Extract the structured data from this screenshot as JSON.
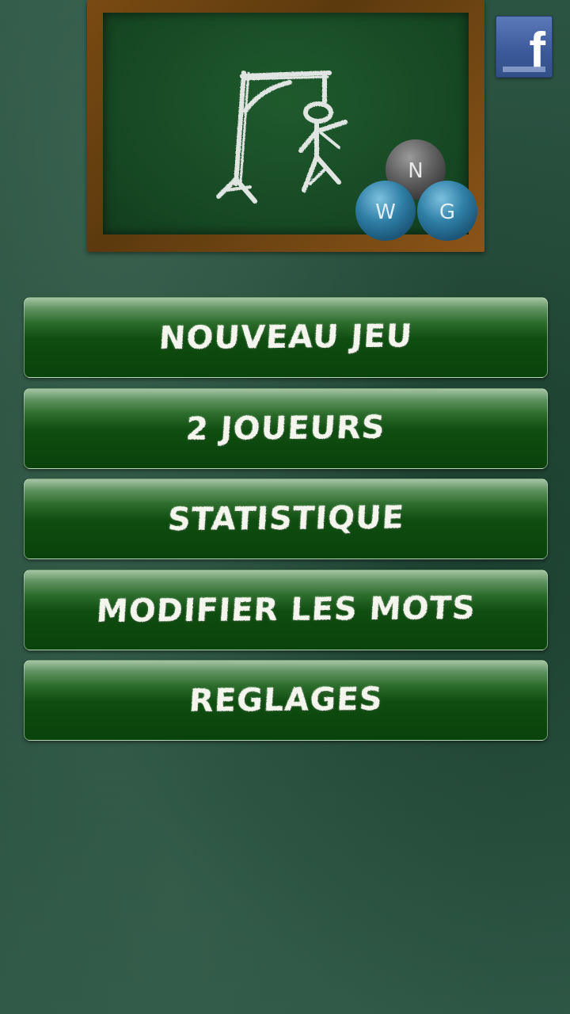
{
  "logo": {
    "letters": [
      "N",
      "W",
      "G"
    ],
    "ball_colors": {
      "N": "#6a6a6a",
      "W": "#2f7fa6",
      "G": "#2f7fa6"
    }
  },
  "facebook": {
    "icon": "facebook-icon",
    "glyph": "f",
    "color": "#3b5998"
  },
  "menu": {
    "items": [
      {
        "label": "NOUVEAU JEU"
      },
      {
        "label": "2 JOUEURS"
      },
      {
        "label": "STATISTIQUE"
      },
      {
        "label": "MODIFIER LES MOTS"
      },
      {
        "label": "REGLAGES"
      }
    ]
  },
  "colors": {
    "background": "#2a5140",
    "board": "#184a25",
    "frame": "#6b4210",
    "button": "#0f4d10",
    "text": "#f4f6ee"
  }
}
